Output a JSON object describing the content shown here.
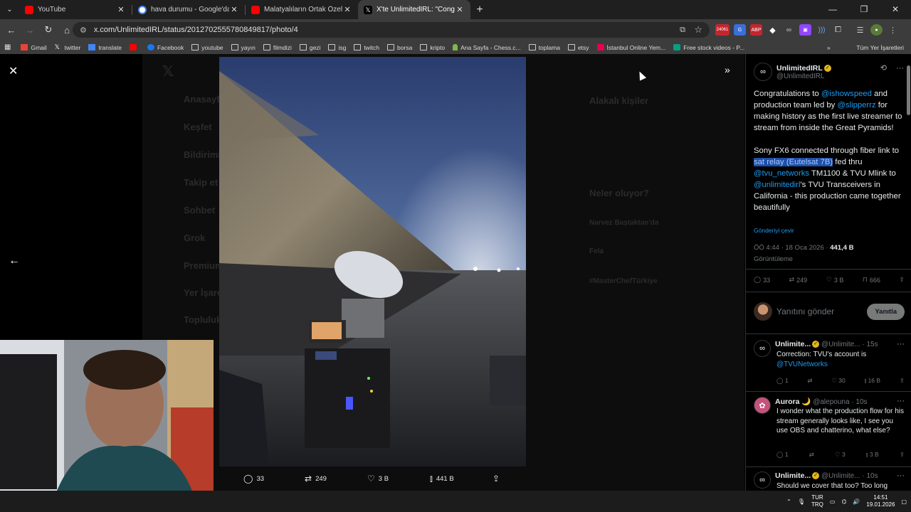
{
  "browser": {
    "tabs": [
      {
        "title": "YouTube",
        "color": "#ff0000",
        "active": false
      },
      {
        "title": "hava durumu - Google'da Ara",
        "color": "#4285f4",
        "active": false
      },
      {
        "title": "Malatyalıların Ortak Özelliği - Y",
        "color": "#ff0000",
        "active": false
      },
      {
        "title": "X'te UnlimitedIRL: \"Congratulat",
        "color": "#000000",
        "active": true
      }
    ],
    "url": "x.com/UnlimitedIRL/status/2012702555780849817/photo/4",
    "ext_badge": "24061",
    "bookmarks": [
      "Gmail",
      "twitter",
      "translate",
      "",
      "Facebook",
      "youtube",
      "yayın",
      "filmdizi",
      "gezi",
      "isg",
      "twitch",
      "borsa",
      "kripto",
      "Ana Sayfa - Chess.c...",
      "toplama",
      "etsy",
      "İstanbul Online Yem...",
      "Free stock videos - P..."
    ],
    "bookmarks_all": "Tüm Yer İşaretleri"
  },
  "ghost": {
    "left_nav": [
      "Anasayfa",
      "Keşfet",
      "Bildirimler",
      "Takip et",
      "Sohbet",
      "Grok",
      "Premium",
      "Yer İşaretleri",
      "Topluluk"
    ],
    "right_header": "Alakalı kişiler",
    "right_happening": "Neler oluyor?",
    "trend1": "Narvez Baştaktan'da",
    "trend2": "Fela",
    "trend3": "#MasterChefTürkiye"
  },
  "photo_actions": {
    "replies": "33",
    "reposts": "249",
    "likes": "3 B",
    "views": "441 B"
  },
  "post": {
    "author_name": "UnlimitedIRL",
    "author_handle": "@UnlimitedIRL",
    "p1_a": "Congratulations to ",
    "p1_link1": "@ishowspeed",
    "p1_b": " and production team led by ",
    "p1_link2": "@slipperrz",
    "p1_c": " for making history as the first live streamer to stream from inside the Great Pyramids!",
    "p2_a": "Sony FX6 connected through fiber link to ",
    "p2_hl": "sat relay (Eutelsat 7B)",
    "p2_b": " fed thru ",
    "p2_link1": "@tvu_networks",
    "p2_c": " TM1100 & TVU Mlink to ",
    "p2_link2": "@unlimitedirl",
    "p2_d": "'s TVU Transceivers in California - this production came together beautifully",
    "translate": "Gönderiyi çevir",
    "timestamp": "ÖÖ 4:44 · 18 Oca 2026 · ",
    "views_num": "441,4 B",
    "views_label": "Görüntüleme",
    "replies": "33",
    "reposts": "249",
    "likes": "3 B",
    "bookmarks": "666"
  },
  "reply": {
    "placeholder": "Yanıtını gönder",
    "button": "Yanıtla"
  },
  "comments": [
    {
      "name": "Unlimite...",
      "handle": "@Unlimite... · 15s",
      "text_a": "Correction: TVU's account is ",
      "text_link": "@TVUNetworks",
      "replies": "1",
      "reposts": "",
      "likes": "30",
      "views": "16 B"
    },
    {
      "name": "Aurora 🌙",
      "handle": "@alepouna · 10s",
      "text_a": "I wonder what the production flow for his stream generally looks like, I see you use OBS and chatterino, what else?",
      "replies": "1",
      "reposts": "",
      "likes": "3",
      "views": "3 B"
    },
    {
      "name": "Unlimite...",
      "handle": "@Unlimite... · 10s",
      "text_a": "Should we cover that too? Too long"
    }
  ],
  "taskbar": {
    "lang1": "TUR",
    "lang2": "TRQ",
    "time": "14:51",
    "date": "19.01.2026"
  }
}
